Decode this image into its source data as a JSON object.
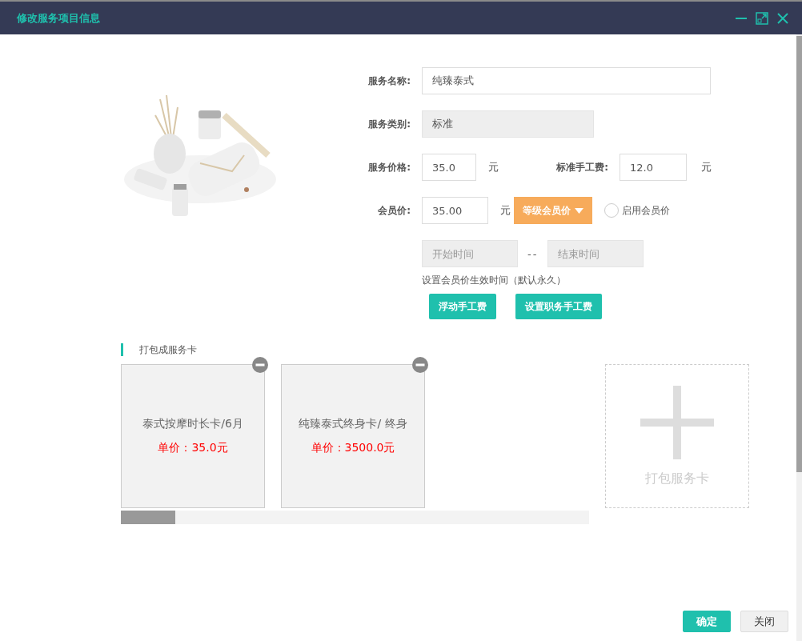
{
  "window": {
    "title": "修改服务项目信息"
  },
  "form": {
    "service_name": {
      "label": "服务名称:",
      "value": "纯臻泰式"
    },
    "category": {
      "label": "服务类别:",
      "value": "标准",
      "disabled": true
    },
    "price": {
      "label": "服务价格:",
      "value": "35.0",
      "unit": "元"
    },
    "labor_fee": {
      "label": "标准手工费:",
      "value": "12.0",
      "unit": "元"
    },
    "member_price": {
      "label": "会员价:",
      "value": "35.00",
      "unit": "元"
    },
    "level_price_button": {
      "label": "等级会员价"
    },
    "enable_member_price": {
      "label": "启用会员价",
      "checked": false
    },
    "start_time": {
      "placeholder": "开始时间"
    },
    "separator": "--",
    "end_time": {
      "placeholder": "结束时间"
    },
    "hint": "设置会员价生效时间（默认永久）",
    "buttons": [
      "浮动手工费",
      "设置职务手工费"
    ]
  },
  "package_section": {
    "title": "打包成服务卡",
    "cards": [
      {
        "name": "泰式按摩时长卡/6月",
        "price": "单价：35.0元"
      },
      {
        "name": "纯臻泰式终身卡/ 终身",
        "price": "单价：3500.0元"
      }
    ],
    "add_card": {
      "label": "打包服务卡"
    }
  },
  "footer_buttons": [
    {
      "label": "确定",
      "kind": "primary"
    },
    {
      "label": "关闭",
      "kind": "default"
    }
  ]
}
